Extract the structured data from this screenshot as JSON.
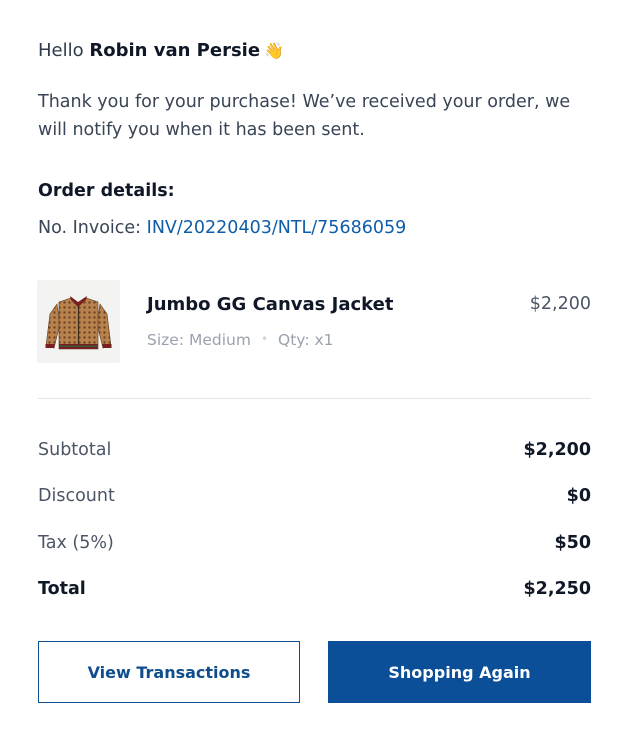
{
  "greeting": {
    "prefix": "Hello",
    "name": "Robin van Persie",
    "emoji": "👋"
  },
  "message": "Thank you for your purchase! We’ve received your order, we will notify you when it has been sent.",
  "order": {
    "title": "Order details:",
    "invoice_label": "No. Invoice:",
    "invoice_number": "INV/20220403/NTL/75686059"
  },
  "product": {
    "name": "Jumbo GG Canvas Jacket",
    "price": "$2,200",
    "size": "Size: Medium",
    "qty": "Qty: x1",
    "image_icon": "jacket-image"
  },
  "summary": {
    "subtotal_label": "Subtotal",
    "subtotal_value": "$2,200",
    "discount_label": "Discount",
    "discount_value": "$0",
    "tax_label": "Tax (5%)",
    "tax_value": "$50",
    "total_label": "Total",
    "total_value": "$2,250"
  },
  "actions": {
    "view_transactions": "View Transactions",
    "shopping_again": "Shopping Again"
  },
  "colors": {
    "accent": "#0b4f98",
    "link": "#0f5da8"
  }
}
